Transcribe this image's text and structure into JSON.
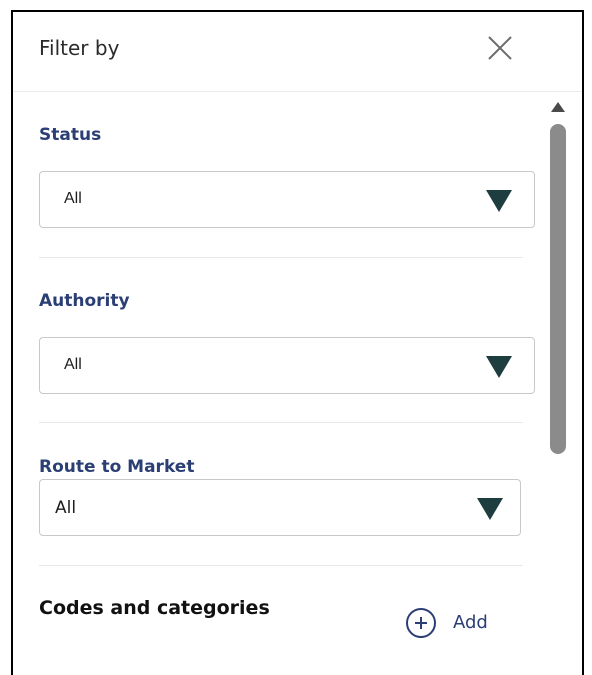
{
  "panel": {
    "title": "Filter by",
    "close_icon": "close-icon"
  },
  "filters": {
    "status": {
      "label": "Status",
      "value": "All"
    },
    "authority": {
      "label": "Authority",
      "value": "All"
    },
    "route_to_market": {
      "label": "Route to Market",
      "value": "All"
    }
  },
  "codes": {
    "label": "Codes and categories",
    "add_label": "Add",
    "add_icon": "plus-circle-icon"
  },
  "colors": {
    "label_blue": "#2c3f75",
    "arrow_dark": "#1e3d3f",
    "scroll_thumb": "#8b8b8b"
  }
}
